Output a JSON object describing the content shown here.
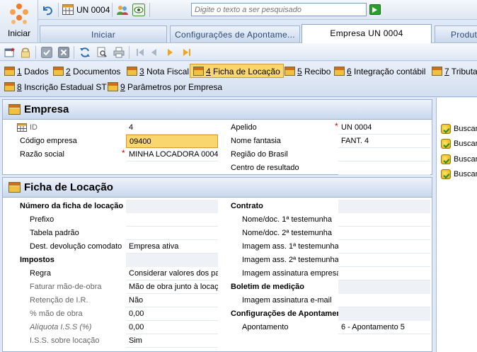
{
  "app": {
    "start_label": "Iniciar",
    "company_short": "UN 0004",
    "search_placeholder": "Digite o texto a ser pesquisado"
  },
  "tabs": [
    {
      "label": "Iniciar",
      "active": false
    },
    {
      "label": "Configurações de Apontame...",
      "active": false
    },
    {
      "label": "Empresa UN 0004",
      "active": true
    },
    {
      "label": "Produt",
      "active": false
    }
  ],
  "subtabs": [
    {
      "num": "1",
      "label": " Dados",
      "active": false
    },
    {
      "num": "2",
      "label": " Documentos",
      "active": false
    },
    {
      "num": "3",
      "label": " Nota Fiscal",
      "active": false
    },
    {
      "num": "4",
      "label": " Ficha de Locação",
      "active": true
    },
    {
      "num": "5",
      "label": " Recibo",
      "active": false
    },
    {
      "num": "6",
      "label": " Integração contábil",
      "active": false
    },
    {
      "num": "7",
      "label": " Tributa",
      "active": false
    },
    {
      "num": "8",
      "label": " Inscrição Estadual ST",
      "active": false
    },
    {
      "num": "9",
      "label": " Parâmetros por Empresa",
      "active": false
    }
  ],
  "empresa": {
    "title": "Empresa",
    "id_label": "ID",
    "id_value": "4",
    "codigo_label": "Código empresa",
    "codigo_value": "09400",
    "razao_label": "Razão social",
    "razao_value": "MINHA LOCADORA 0004",
    "apelido_label": "Apelido",
    "apelido_value": "UN 0004",
    "fantasia_label": "Nome fantasia",
    "fantasia_value": "FANT. 4",
    "regiao_label": "Região do Brasil",
    "regiao_value": "",
    "centro_label": "Centro de resultado",
    "centro_value": ""
  },
  "ficha": {
    "title": "Ficha de Locação",
    "numero_label": "Número da ficha de locação",
    "prefixo_label": "Prefixo",
    "prefixo_value": "",
    "tabela_label": "Tabela padrão",
    "tabela_value": "",
    "dest_label": "Dest. devolução comodato",
    "dest_value": "Empresa ativa",
    "impostos_label": "Impostos",
    "regra_label": "Regra",
    "regra_value": "Considerar valores dos pa",
    "faturar_label": "Faturar mão-de-obra",
    "faturar_value": "Mão de obra junto à locação",
    "retencao_label": "Retenção de I.R.",
    "retencao_value": "Não",
    "pct_label": "% mão de obra",
    "pct_value": "0,00",
    "aliquota_label": "Alíquota I.S.S (%)",
    "aliquota_value": "0,00",
    "iss_label": "I.S.S. sobre locação",
    "iss_value": "Sim",
    "contrato_label": "Contrato",
    "test1_label": "Nome/doc. 1ª testemunha",
    "test2_label": "Nome/doc. 2ª testemunha",
    "img1_label": "Imagem ass. 1ª testemunha",
    "img2_label": "Imagem ass. 2ª testemunha",
    "imgemp_label": "Imagem assinatura empresa",
    "boletim_label": "Boletim de medição",
    "imgemail_label": "Imagem assinatura e-mail",
    "config_label": "Configurações de Apontamento",
    "apont_label": "Apontamento",
    "apont_value": "6 - Apontamento 5"
  },
  "buscar": [
    "Buscar",
    "Buscar",
    "Buscar",
    "Buscar"
  ]
}
